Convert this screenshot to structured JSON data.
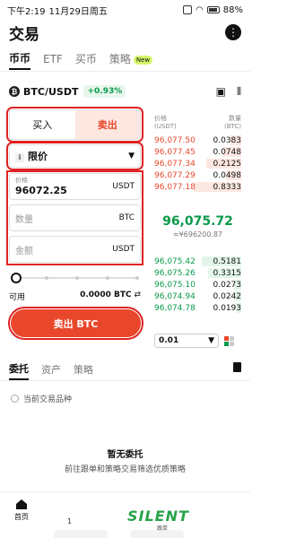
{
  "status_bar": {
    "time": "下午2:19",
    "date": "11月29日周五",
    "battery": "88%"
  },
  "header": {
    "title": "交易",
    "more_icon": "more-dots-icon"
  },
  "top_tabs": [
    {
      "label": "币币",
      "active": true
    },
    {
      "label": "ETF",
      "active": false
    },
    {
      "label": "买币",
      "active": false
    },
    {
      "label": "策略",
      "active": false,
      "badge": "New"
    }
  ],
  "pair": {
    "name": "BTC/USDT",
    "change": "+0.93%"
  },
  "order_form": {
    "buy_label": "买入",
    "sell_label": "卖出",
    "order_type": "限价",
    "price_label": "价格",
    "price_value": "96072.25",
    "price_unit": "USDT",
    "amount_placeholder": "数量",
    "amount_unit": "BTC",
    "total_placeholder": "金额",
    "total_unit": "USDT",
    "available_label": "可用",
    "available_amount": "0.0000 BTC",
    "submit_label": "卖出 BTC"
  },
  "order_book": {
    "price_header": "价格",
    "price_unit": "(USDT)",
    "qty_header": "数量",
    "qty_unit": "(BTC)",
    "asks": [
      {
        "price": "96,077.50",
        "qty": "0.0383",
        "depth": 0.12
      },
      {
        "price": "96,077.45",
        "qty": "0.0748",
        "depth": 0.22
      },
      {
        "price": "96,077.34",
        "qty": "0.2125",
        "depth": 0.4
      },
      {
        "price": "96,077.29",
        "qty": "0.0498",
        "depth": 0.18
      },
      {
        "price": "96,077.18",
        "qty": "0.8333",
        "depth": 0.55
      }
    ],
    "last_price": "96,075.72",
    "fiat_price": "≈¥696200.87",
    "bids": [
      {
        "price": "96,075.42",
        "qty": "0.5181",
        "depth": 0.45
      },
      {
        "price": "96,075.26",
        "qty": "0.3315",
        "depth": 0.38
      },
      {
        "price": "96,075.10",
        "qty": "0.0273",
        "depth": 0.08
      },
      {
        "price": "96,074.94",
        "qty": "0.0242",
        "depth": 0.08
      },
      {
        "price": "96,074.78",
        "qty": "0.0193",
        "depth": 0.06
      }
    ],
    "depth_value": "0.01",
    "colors": {
      "ask": "#e8472c",
      "bid": "#0a9a4a",
      "ask_bg": "#fde7e1",
      "bid_bg": "#e3f5e9"
    }
  },
  "bottom_tabs": [
    {
      "label": "委托",
      "active": true
    },
    {
      "label": "资产",
      "active": false
    },
    {
      "label": "策略",
      "active": false
    }
  ],
  "filter": {
    "label": "当前交易品种"
  },
  "empty_state": {
    "title": "暂无委托",
    "subtitle": "前往跟单和策略交易筛选优质策略"
  },
  "bottom_nav": {
    "home_label": "首页",
    "partial_label": "1"
  },
  "watermark": {
    "text": "SILENT",
    "sub": "跟单"
  }
}
